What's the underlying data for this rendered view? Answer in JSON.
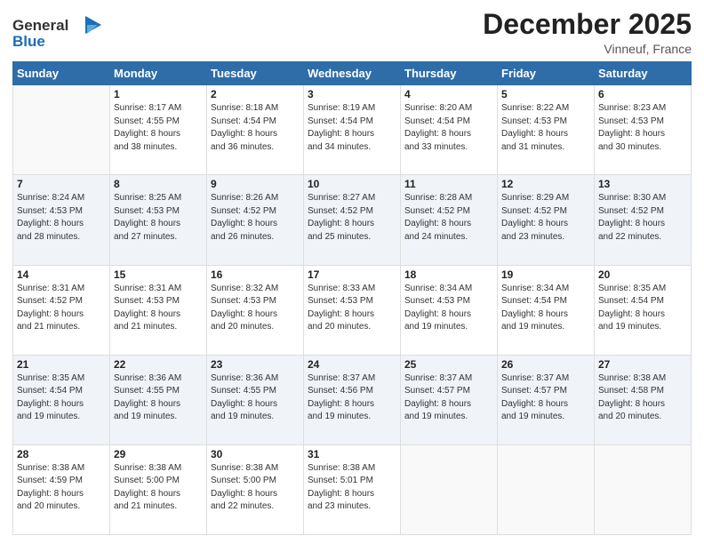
{
  "logo": {
    "line1": "General",
    "line2": "Blue"
  },
  "header": {
    "month": "December 2025",
    "location": "Vinneuf, France"
  },
  "weekdays": [
    "Sunday",
    "Monday",
    "Tuesday",
    "Wednesday",
    "Thursday",
    "Friday",
    "Saturday"
  ],
  "weeks": [
    [
      {
        "day": "",
        "info": ""
      },
      {
        "day": "1",
        "info": "Sunrise: 8:17 AM\nSunset: 4:55 PM\nDaylight: 8 hours\nand 38 minutes."
      },
      {
        "day": "2",
        "info": "Sunrise: 8:18 AM\nSunset: 4:54 PM\nDaylight: 8 hours\nand 36 minutes."
      },
      {
        "day": "3",
        "info": "Sunrise: 8:19 AM\nSunset: 4:54 PM\nDaylight: 8 hours\nand 34 minutes."
      },
      {
        "day": "4",
        "info": "Sunrise: 8:20 AM\nSunset: 4:54 PM\nDaylight: 8 hours\nand 33 minutes."
      },
      {
        "day": "5",
        "info": "Sunrise: 8:22 AM\nSunset: 4:53 PM\nDaylight: 8 hours\nand 31 minutes."
      },
      {
        "day": "6",
        "info": "Sunrise: 8:23 AM\nSunset: 4:53 PM\nDaylight: 8 hours\nand 30 minutes."
      }
    ],
    [
      {
        "day": "7",
        "info": "Sunrise: 8:24 AM\nSunset: 4:53 PM\nDaylight: 8 hours\nand 28 minutes."
      },
      {
        "day": "8",
        "info": "Sunrise: 8:25 AM\nSunset: 4:53 PM\nDaylight: 8 hours\nand 27 minutes."
      },
      {
        "day": "9",
        "info": "Sunrise: 8:26 AM\nSunset: 4:52 PM\nDaylight: 8 hours\nand 26 minutes."
      },
      {
        "day": "10",
        "info": "Sunrise: 8:27 AM\nSunset: 4:52 PM\nDaylight: 8 hours\nand 25 minutes."
      },
      {
        "day": "11",
        "info": "Sunrise: 8:28 AM\nSunset: 4:52 PM\nDaylight: 8 hours\nand 24 minutes."
      },
      {
        "day": "12",
        "info": "Sunrise: 8:29 AM\nSunset: 4:52 PM\nDaylight: 8 hours\nand 23 minutes."
      },
      {
        "day": "13",
        "info": "Sunrise: 8:30 AM\nSunset: 4:52 PM\nDaylight: 8 hours\nand 22 minutes."
      }
    ],
    [
      {
        "day": "14",
        "info": "Sunrise: 8:31 AM\nSunset: 4:52 PM\nDaylight: 8 hours\nand 21 minutes."
      },
      {
        "day": "15",
        "info": "Sunrise: 8:31 AM\nSunset: 4:53 PM\nDaylight: 8 hours\nand 21 minutes."
      },
      {
        "day": "16",
        "info": "Sunrise: 8:32 AM\nSunset: 4:53 PM\nDaylight: 8 hours\nand 20 minutes."
      },
      {
        "day": "17",
        "info": "Sunrise: 8:33 AM\nSunset: 4:53 PM\nDaylight: 8 hours\nand 20 minutes."
      },
      {
        "day": "18",
        "info": "Sunrise: 8:34 AM\nSunset: 4:53 PM\nDaylight: 8 hours\nand 19 minutes."
      },
      {
        "day": "19",
        "info": "Sunrise: 8:34 AM\nSunset: 4:54 PM\nDaylight: 8 hours\nand 19 minutes."
      },
      {
        "day": "20",
        "info": "Sunrise: 8:35 AM\nSunset: 4:54 PM\nDaylight: 8 hours\nand 19 minutes."
      }
    ],
    [
      {
        "day": "21",
        "info": "Sunrise: 8:35 AM\nSunset: 4:54 PM\nDaylight: 8 hours\nand 19 minutes."
      },
      {
        "day": "22",
        "info": "Sunrise: 8:36 AM\nSunset: 4:55 PM\nDaylight: 8 hours\nand 19 minutes."
      },
      {
        "day": "23",
        "info": "Sunrise: 8:36 AM\nSunset: 4:55 PM\nDaylight: 8 hours\nand 19 minutes."
      },
      {
        "day": "24",
        "info": "Sunrise: 8:37 AM\nSunset: 4:56 PM\nDaylight: 8 hours\nand 19 minutes."
      },
      {
        "day": "25",
        "info": "Sunrise: 8:37 AM\nSunset: 4:57 PM\nDaylight: 8 hours\nand 19 minutes."
      },
      {
        "day": "26",
        "info": "Sunrise: 8:37 AM\nSunset: 4:57 PM\nDaylight: 8 hours\nand 19 minutes."
      },
      {
        "day": "27",
        "info": "Sunrise: 8:38 AM\nSunset: 4:58 PM\nDaylight: 8 hours\nand 20 minutes."
      }
    ],
    [
      {
        "day": "28",
        "info": "Sunrise: 8:38 AM\nSunset: 4:59 PM\nDaylight: 8 hours\nand 20 minutes."
      },
      {
        "day": "29",
        "info": "Sunrise: 8:38 AM\nSunset: 5:00 PM\nDaylight: 8 hours\nand 21 minutes."
      },
      {
        "day": "30",
        "info": "Sunrise: 8:38 AM\nSunset: 5:00 PM\nDaylight: 8 hours\nand 22 minutes."
      },
      {
        "day": "31",
        "info": "Sunrise: 8:38 AM\nSunset: 5:01 PM\nDaylight: 8 hours\nand 23 minutes."
      },
      {
        "day": "",
        "info": ""
      },
      {
        "day": "",
        "info": ""
      },
      {
        "day": "",
        "info": ""
      }
    ]
  ]
}
